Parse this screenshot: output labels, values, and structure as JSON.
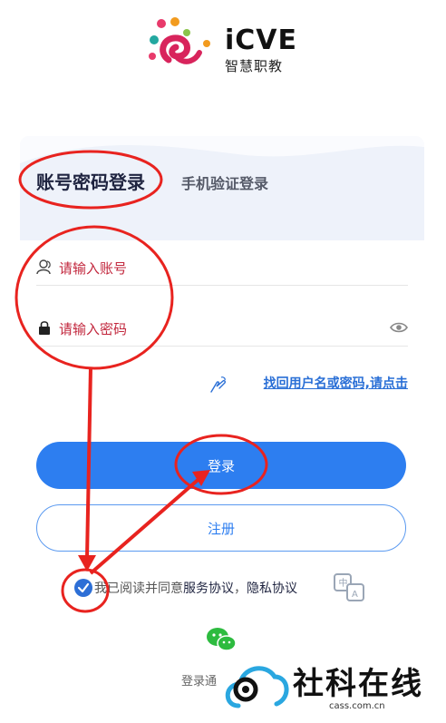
{
  "brand": {
    "title": "iCVE",
    "subtitle": "智慧职教"
  },
  "tabs": [
    {
      "label": "账号密码登录",
      "active": true
    },
    {
      "label": "手机验证登录",
      "active": false
    }
  ],
  "form": {
    "account_placeholder": "请输入账号",
    "password_placeholder": "请输入密码"
  },
  "forgot_label": "找回用户名或密码,请点击",
  "buttons": {
    "login": "登录",
    "register": "注册"
  },
  "agreement": {
    "prefix": "我已阅读并同意",
    "service": "服务协议",
    "separator": "，",
    "privacy": "隐私协议",
    "checked": true
  },
  "other_login_label": "登录通",
  "watermark": {
    "name": "社科在线",
    "domain": "cass.com.cn"
  },
  "colors": {
    "accent": "#2d7ef0",
    "annotation": "#e8231f",
    "placeholder": "#c2273d"
  },
  "icons": [
    "user-icon",
    "lock-icon",
    "eye-icon",
    "hand-pointer-icon",
    "checkmark-icon",
    "translate-icon",
    "wechat-icon"
  ]
}
